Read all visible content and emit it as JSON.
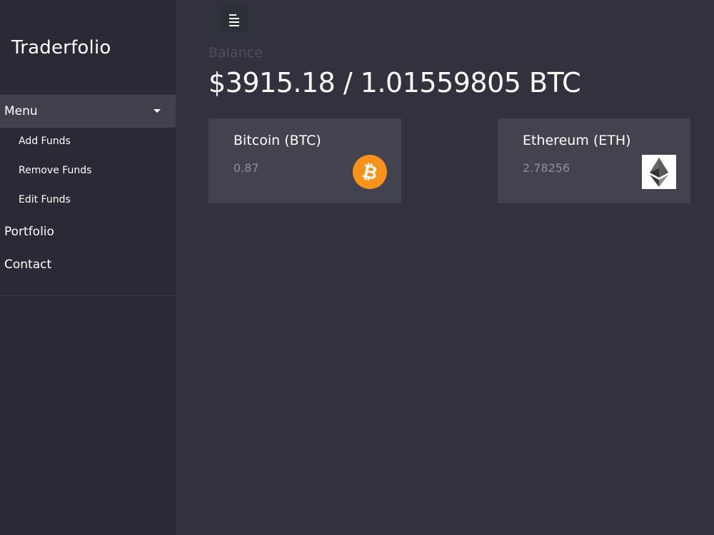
{
  "sidebar": {
    "brand": "Traderfolio",
    "menu": {
      "label": "Menu",
      "items": [
        {
          "label": "Add Funds"
        },
        {
          "label": "Remove Funds"
        },
        {
          "label": "Edit Funds"
        }
      ]
    },
    "nav": [
      {
        "label": "Portfolio"
      },
      {
        "label": "Contact"
      }
    ]
  },
  "header": {
    "toggle_icon": "hamburger-menu-icon"
  },
  "balance": {
    "label": "Balance",
    "value": "$3915.18 / 1.01559805 BTC"
  },
  "cards": [
    {
      "title": "Bitcoin (BTC)",
      "amount": "0.87",
      "icon": "bitcoin-icon",
      "accent": "#f7931a"
    },
    {
      "title": "Ethereum (ETH)",
      "amount": "2.78256",
      "icon": "ethereum-icon",
      "accent": "#ffffff"
    }
  ],
  "colors": {
    "background": "#32323e",
    "sidebar": "#2a2a36",
    "card": "#434350",
    "menu_active": "#41414e"
  }
}
